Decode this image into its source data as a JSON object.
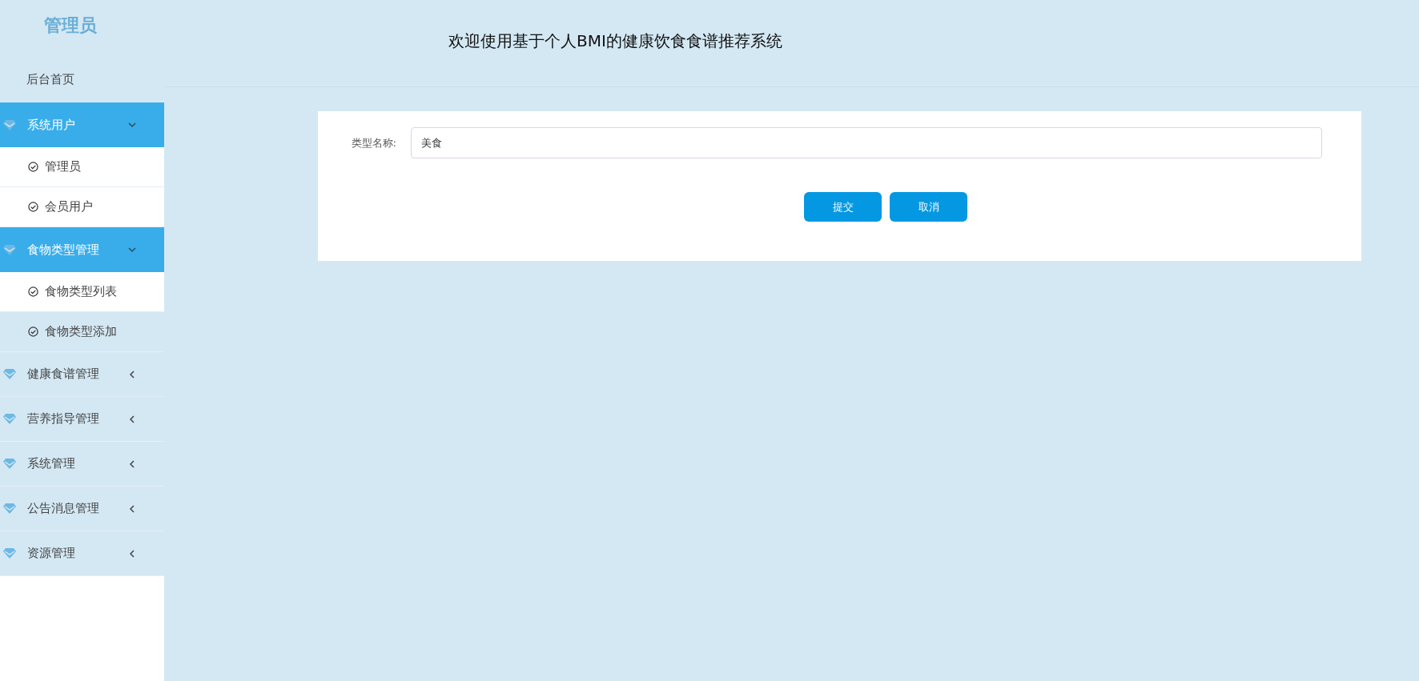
{
  "sidebar": {
    "title": "管理员",
    "items": [
      {
        "kind": "link",
        "label": "后台首页"
      },
      {
        "kind": "group",
        "label": "系统用户",
        "expanded": true,
        "children": [
          {
            "label": "管理员",
            "selected": false
          },
          {
            "label": "会员用户",
            "selected": false
          }
        ]
      },
      {
        "kind": "group",
        "label": "食物类型管理",
        "expanded": true,
        "children": [
          {
            "label": "食物类型列表",
            "selected": false
          },
          {
            "label": "食物类型添加",
            "selected": true
          }
        ]
      },
      {
        "kind": "group",
        "label": "健康食谱管理",
        "expanded": false
      },
      {
        "kind": "group",
        "label": "营养指导管理",
        "expanded": false
      },
      {
        "kind": "group",
        "label": "系统管理",
        "expanded": false
      },
      {
        "kind": "group",
        "label": "公告消息管理",
        "expanded": false
      },
      {
        "kind": "group",
        "label": "资源管理",
        "expanded": false
      }
    ]
  },
  "header": {
    "title": "欢迎使用基于个人BMI的健康饮食食谱推荐系统"
  },
  "form": {
    "fields": [
      {
        "label": "类型名称:",
        "value": "美食"
      }
    ],
    "buttons": [
      "提交",
      "取消"
    ]
  }
}
